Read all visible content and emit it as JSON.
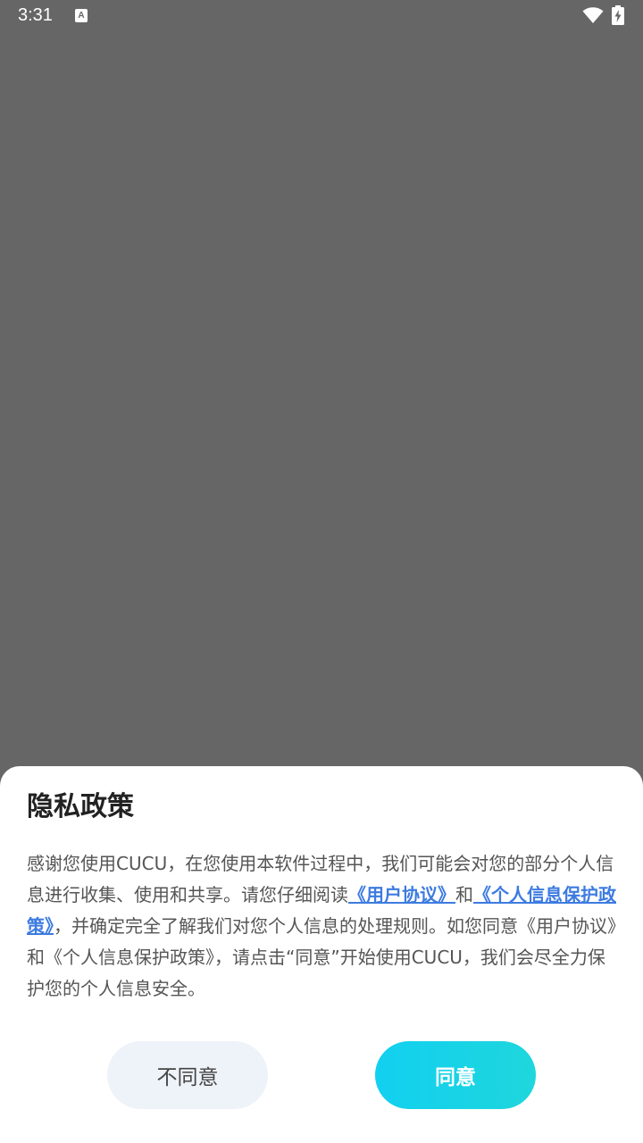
{
  "status_bar": {
    "time": "3:31",
    "notification_icon_letter": "A",
    "icons": [
      "a-notification-icon",
      "wifi-icon",
      "battery-charging-icon"
    ]
  },
  "dialog": {
    "title": "隐私政策",
    "body_intro": "感谢您使用CUCU，在您使用本软件过程中，我们可能会对您的部分个人信息进行收集、使用和共享。请您仔细阅读",
    "user_agreement_link": "《用户协议》",
    "conjunction": "和",
    "privacy_policy_link": "《个人信息保护政策》",
    "body_rest": "，并确定完全了解我们对您个人信息的处理规则。如您同意《用户协议》和《个人信息保护政策》，请点击“同意”开始使用CUCU，我们会尽全力保护您的个人信息安全。",
    "disagree_label": "不同意",
    "agree_label": "同意"
  },
  "colors": {
    "backdrop": "#666666",
    "link": "#3d7be0",
    "agree_gradient_start": "#12d0f0",
    "agree_gradient_end": "#1ed6dc",
    "disagree_bg": "#eef2f9"
  }
}
